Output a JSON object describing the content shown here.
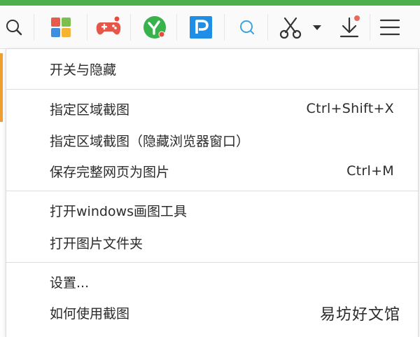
{
  "toolbar": {
    "icons": [
      "search-icon",
      "apps-grid-icon",
      "game-controller-icon",
      "green-app-icon",
      "pdf-p-icon",
      "search-circle-icon",
      "scissors-icon",
      "chevron-down-icon",
      "download-icon",
      "hamburger-menu-icon"
    ],
    "colors": {
      "accent_green": "#4cb04a",
      "grid_red": "#e85b4a",
      "grid_green": "#7dbf4d",
      "grid_blue": "#3d8fe0",
      "grid_yellow": "#f4b333",
      "game_red": "#e4574a",
      "badge_red": "#e74c3c",
      "app_green": "#38b24a",
      "p_blue": "#1f8ee6",
      "search_blue": "#3aa3e0",
      "icon_dark": "#333333"
    }
  },
  "menu": {
    "groups": [
      {
        "items": [
          {
            "label": "开关与隐藏",
            "shortcut": ""
          }
        ]
      },
      {
        "items": [
          {
            "label": "指定区域截图",
            "shortcut": "Ctrl+Shift+X"
          },
          {
            "label": "指定区域截图（隐藏浏览器窗口）",
            "shortcut": ""
          },
          {
            "label": "保存完整网页为图片",
            "shortcut": "Ctrl+M"
          }
        ]
      },
      {
        "items": [
          {
            "label": "打开windows画图工具",
            "shortcut": ""
          },
          {
            "label": "打开图片文件夹",
            "shortcut": ""
          }
        ]
      },
      {
        "items": [
          {
            "label": "设置...",
            "shortcut": ""
          },
          {
            "label": "如何使用截图",
            "shortcut": ""
          }
        ]
      }
    ]
  },
  "watermark": "易坊好文馆"
}
